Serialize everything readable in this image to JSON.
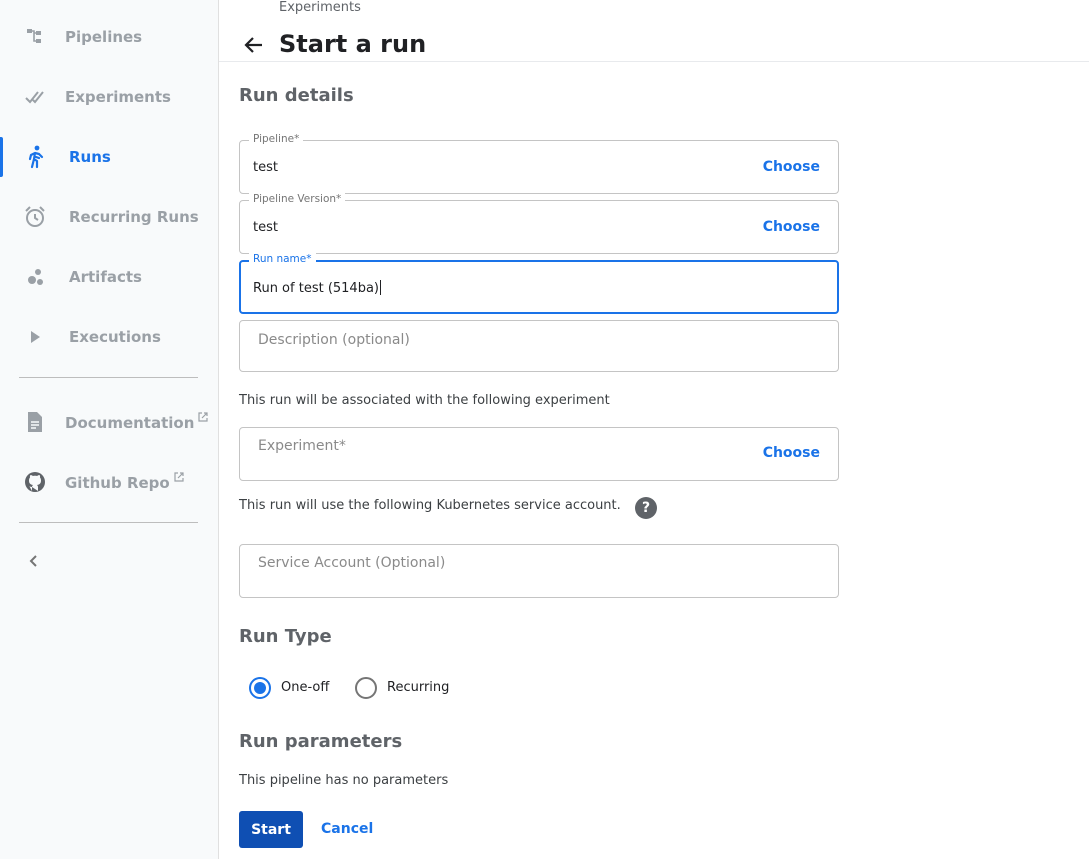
{
  "sidebar": {
    "items": [
      {
        "label": "Pipelines",
        "icon": "pipelines-icon"
      },
      {
        "label": "Experiments",
        "icon": "experiments-icon"
      },
      {
        "label": "Runs",
        "icon": "runs-icon",
        "active": true
      },
      {
        "label": "Recurring Runs",
        "icon": "alarm-clock-icon"
      },
      {
        "label": "Artifacts",
        "icon": "artifacts-icon"
      },
      {
        "label": "Executions",
        "icon": "play-icon"
      }
    ],
    "links": [
      {
        "label": "Documentation",
        "icon": "document-icon"
      },
      {
        "label": "Github Repo",
        "icon": "github-icon"
      }
    ]
  },
  "header": {
    "breadcrumb": "Experiments",
    "title": "Start a run"
  },
  "form": {
    "run_details_title": "Run details",
    "pipeline": {
      "label": "Pipeline",
      "required": "*",
      "value": "test",
      "action": "Choose"
    },
    "pipeline_version": {
      "label": "Pipeline Version",
      "required": "*",
      "value": "test",
      "action": "Choose"
    },
    "run_name": {
      "label": "Run name",
      "required": "*",
      "value": "Run of test (514ba)"
    },
    "description": {
      "placeholder": "Description (optional)"
    },
    "experiment_helper": "This run will be associated with the following experiment",
    "experiment": {
      "placeholder": "Experiment",
      "required": "*",
      "action": "Choose"
    },
    "service_account_helper": "This run will use the following Kubernetes service account.",
    "help_icon": "?",
    "service_account": {
      "placeholder": "Service Account (Optional)"
    },
    "run_type_title": "Run Type",
    "run_type_options": [
      {
        "label": "One-off",
        "checked": true
      },
      {
        "label": "Recurring",
        "checked": false
      }
    ],
    "run_parameters_title": "Run parameters",
    "run_parameters_helper": "This pipeline has no parameters",
    "start_label": "Start",
    "cancel_label": "Cancel"
  },
  "colors": {
    "accent": "#1a73e8",
    "primary_button": "#0f4fb3",
    "sidebar_bg": "#f8fafb"
  }
}
